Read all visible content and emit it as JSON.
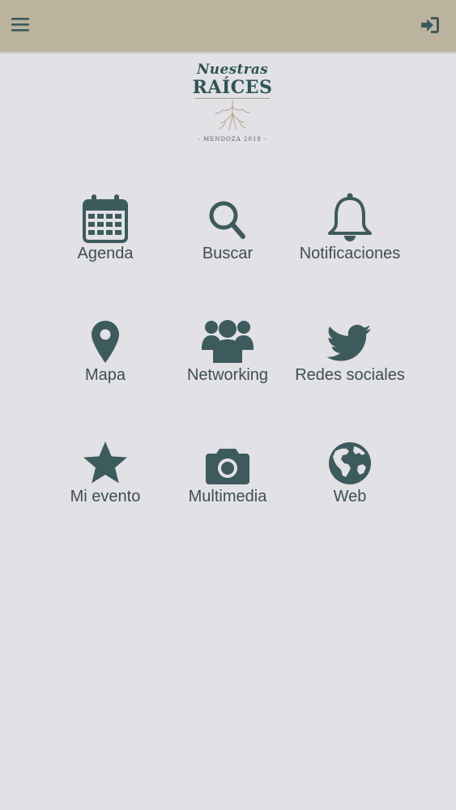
{
  "header": {
    "menu_icon": "hamburger-menu-icon",
    "login_icon": "sign-in-icon",
    "background": "#bcb39f"
  },
  "logo": {
    "line1": "Nuestras",
    "line2": "RAÍCES",
    "line3": "- MENDOZA 2018 -"
  },
  "grid": {
    "icon_color": "#3d5a5c",
    "items": [
      {
        "label": "Agenda",
        "icon": "calendar-icon"
      },
      {
        "label": "Buscar",
        "icon": "search-icon"
      },
      {
        "label": "Notificaciones",
        "icon": "bell-icon"
      },
      {
        "label": "Mapa",
        "icon": "map-marker-icon"
      },
      {
        "label": "Networking",
        "icon": "users-icon"
      },
      {
        "label": "Redes sociales",
        "icon": "twitter-icon"
      },
      {
        "label": "Mi evento",
        "icon": "star-icon"
      },
      {
        "label": "Multimedia",
        "icon": "camera-icon"
      },
      {
        "label": "Web",
        "icon": "globe-icon"
      }
    ]
  }
}
